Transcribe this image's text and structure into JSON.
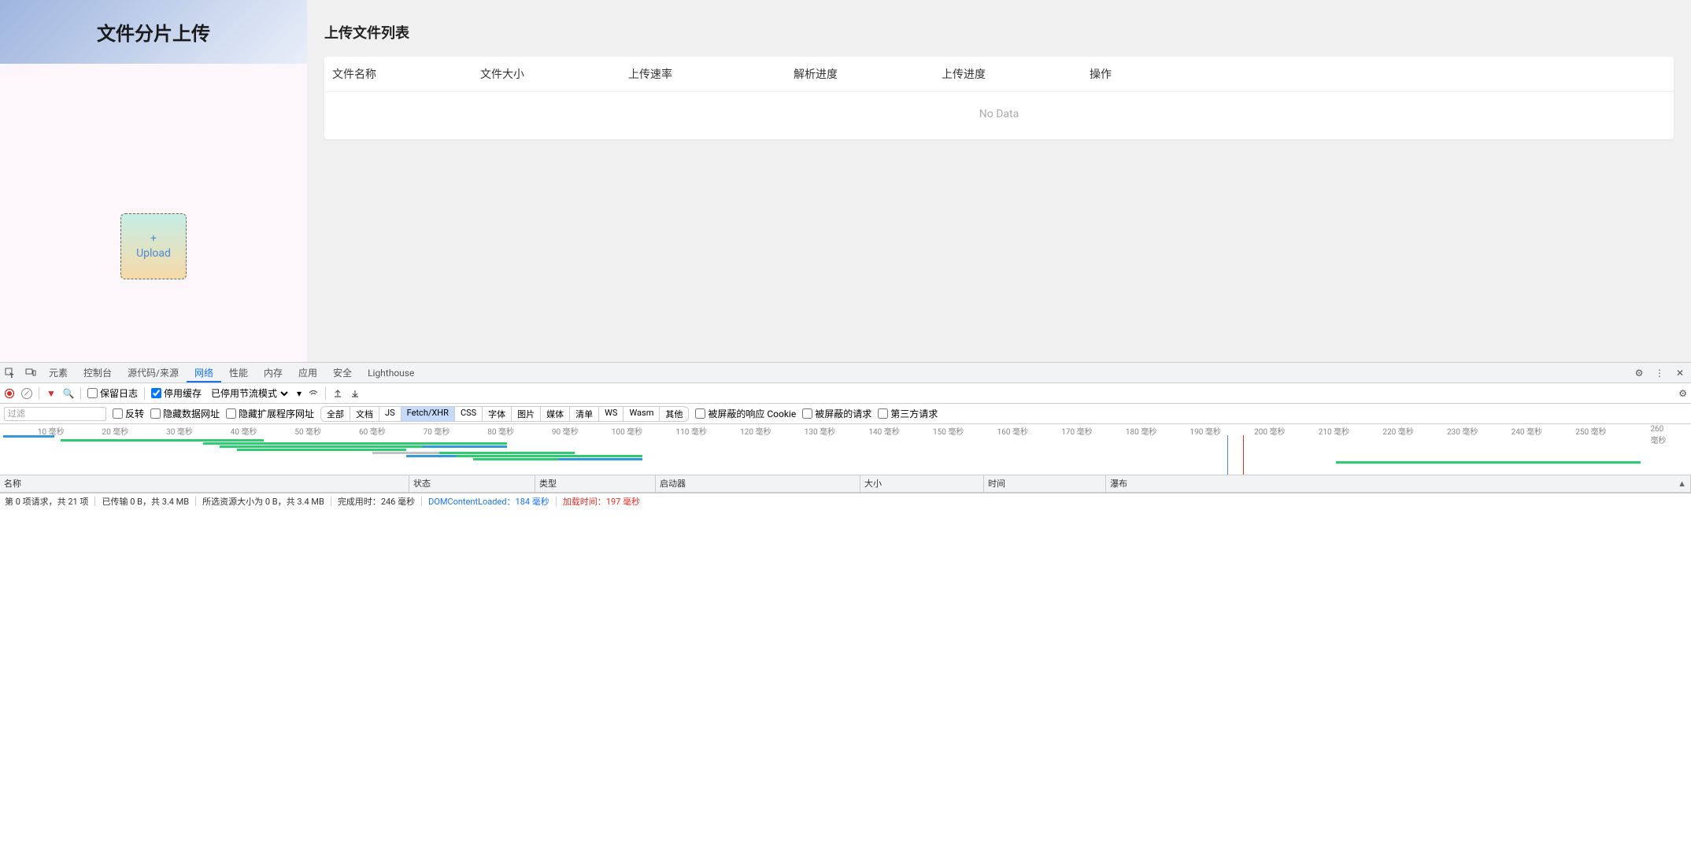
{
  "app": {
    "sidebar_title": "文件分片上传",
    "upload_plus": "+",
    "upload_label": "Upload"
  },
  "main": {
    "title": "上传文件列表",
    "cols": {
      "name": "文件名称",
      "size": "文件大小",
      "speed": "上传速率",
      "parse": "解析进度",
      "upload": "上传进度",
      "action": "操作"
    },
    "empty": "No Data"
  },
  "devtools": {
    "tabs": [
      "元素",
      "控制台",
      "源代码/来源",
      "网络",
      "性能",
      "内存",
      "应用",
      "安全",
      "Lighthouse"
    ],
    "active_tab_index": 3,
    "toolbar": {
      "preserve_log": "保留日志",
      "disable_cache": "停用缓存",
      "throttling": "已停用节流模式"
    },
    "filterbar": {
      "filter_placeholder": "过滤",
      "invert": "反转",
      "hide_data_urls": "隐藏数据网址",
      "hide_ext_urls": "隐藏扩展程序网址",
      "chips": [
        "全部",
        "文档",
        "JS",
        "Fetch/XHR",
        "CSS",
        "字体",
        "图片",
        "媒体",
        "清单",
        "WS",
        "Wasm",
        "其他"
      ],
      "active_chip_index": 3,
      "blocked_cookies": "被屏蔽的响应 Cookie",
      "blocked_req": "被屏蔽的请求",
      "third_party": "第三方请求"
    },
    "overview_ticks": [
      "10 毫秒",
      "20 毫秒",
      "30 毫秒",
      "40 毫秒",
      "50 毫秒",
      "60 毫秒",
      "70 毫秒",
      "80 毫秒",
      "90 毫秒",
      "100 毫秒",
      "110 毫秒",
      "120 毫秒",
      "130 毫秒",
      "140 毫秒",
      "150 毫秒",
      "160 毫秒",
      "170 毫秒",
      "180 毫秒",
      "190 毫秒",
      "200 毫秒",
      "210 毫秒",
      "220 毫秒",
      "230 毫秒",
      "240 毫秒",
      "250 毫秒",
      "260 毫秒"
    ],
    "request_cols": {
      "name": "名称",
      "status": "状态",
      "type": "类型",
      "initiator": "启动器",
      "size": "大小",
      "time": "时间",
      "waterfall": "瀑布"
    },
    "sort_glyph": "▲",
    "status": {
      "requests": "第 0 项请求，共 21 项",
      "transferred": "已传输 0 B，共 3.4 MB",
      "resources": "所选资源大小为 0 B，共 3.4 MB",
      "finish_label": "完成用时：",
      "finish_val": "246 毫秒",
      "dcl_label": "DOMContentLoaded：",
      "dcl_val": "184 毫秒",
      "load_label": "加载时间：",
      "load_val": "197 毫秒"
    }
  }
}
